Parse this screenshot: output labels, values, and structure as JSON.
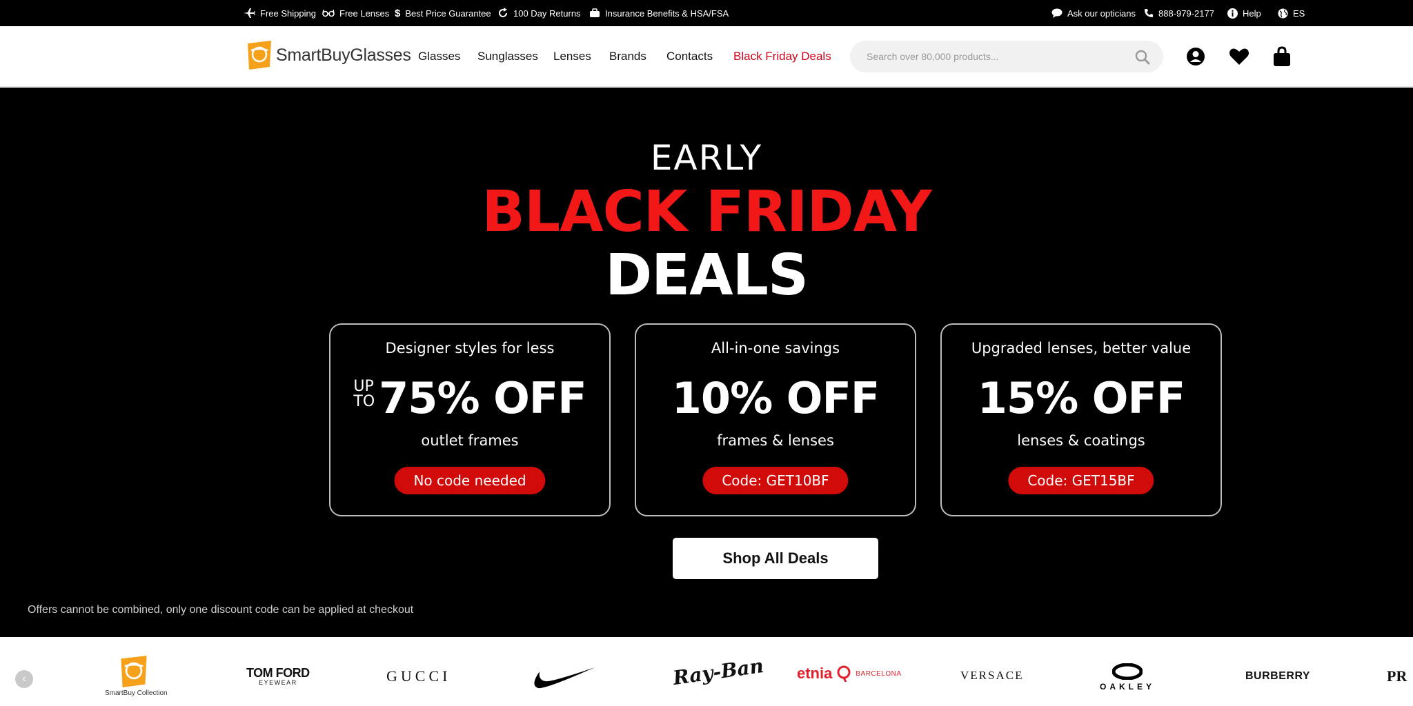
{
  "topbar": {
    "items": [
      {
        "icon": "plane-icon",
        "label": "Free Shipping"
      },
      {
        "icon": "glasses-icon",
        "label": "Free Lenses"
      },
      {
        "icon": "dollar-icon",
        "label": "Best Price Guarantee"
      },
      {
        "icon": "returns-icon",
        "label": "100 Day Returns"
      },
      {
        "icon": "insurance-icon",
        "label": "Insurance Benefits & HSA/FSA"
      }
    ],
    "right": [
      {
        "icon": "chat-icon",
        "label": "Ask our opticians"
      },
      {
        "icon": "phone-icon",
        "label": "888-979-2177"
      },
      {
        "icon": "info-icon",
        "label": "Help"
      },
      {
        "icon": "globe-icon",
        "label": "ES"
      }
    ]
  },
  "header": {
    "logo_text": "SmartBuyGlasses",
    "nav": [
      "Glasses",
      "Sunglasses",
      "Lenses",
      "Brands",
      "Contacts",
      "Black Friday Deals"
    ],
    "search_placeholder": "Search over 80,000 products...",
    "icons": [
      "account-icon",
      "wishlist-heart-icon",
      "shopping-bag-icon"
    ]
  },
  "hero": {
    "line1": "EARLY",
    "line2": "BLACK FRIDAY",
    "line3": "DEALS",
    "cards": [
      {
        "title": "Designer styles for less",
        "upto_top": "UP",
        "upto_bottom": "TO",
        "big": "75% OFF",
        "sub": "outlet frames",
        "badge": "No code needed"
      },
      {
        "title": "All-in-one savings",
        "big": "10% OFF",
        "sub": "frames & lenses",
        "badge": "Code: GET10BF"
      },
      {
        "title": "Upgraded lenses, better value",
        "big": "15% OFF",
        "sub": "lenses & coatings",
        "badge": "Code: GET15BF"
      }
    ],
    "cta": "Shop All Deals",
    "disclaimer": "Offers cannot be combined, only one discount code can be applied at checkout"
  },
  "brands": {
    "items": [
      {
        "name": "SmartBuy Collection",
        "label": "SmartBuy Collection"
      },
      {
        "name": "TOM FORD",
        "label": "TOM FORD",
        "sub": "EYEWEAR"
      },
      {
        "name": "GUCCI",
        "label": "GUCCI"
      },
      {
        "name": "Nike",
        "label": ""
      },
      {
        "name": "Ray-Ban",
        "label": "Ray-Ban"
      },
      {
        "name": "etnia",
        "label": "etnia",
        "sub": "BARCELONA"
      },
      {
        "name": "VERSACE",
        "label": "VERSACE"
      },
      {
        "name": "OAKLEY",
        "label": "OAKLEY"
      },
      {
        "name": "BURBERRY",
        "label": "BURBERRY"
      },
      {
        "name": "PRADA",
        "label": "PR"
      }
    ]
  }
}
